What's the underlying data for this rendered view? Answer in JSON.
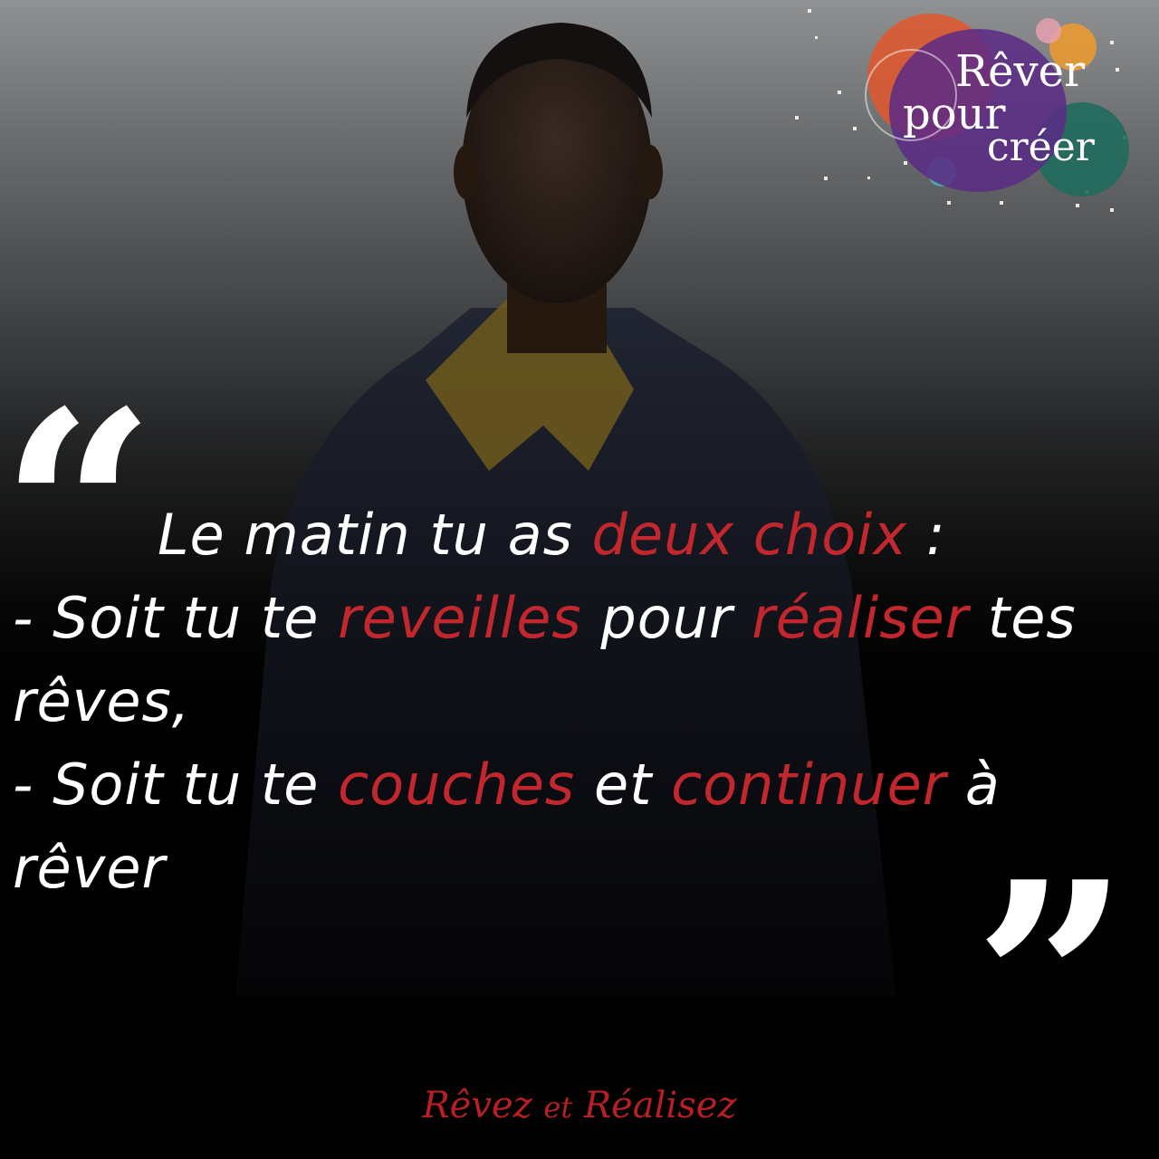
{
  "logo": {
    "line1": "Rêver",
    "line2": "pour",
    "line3": "créer"
  },
  "quote": {
    "open_mark": "“",
    "close_mark": "”",
    "lines": [
      [
        {
          "text": "Le matin tu as ",
          "hl": false
        },
        {
          "text": "deux choix",
          "hl": true
        },
        {
          "text": " :",
          "hl": false
        }
      ],
      [
        {
          "text": "- Soit tu te ",
          "hl": false
        },
        {
          "text": "reveilles",
          "hl": true
        },
        {
          "text": " pour ",
          "hl": false
        },
        {
          "text": "réaliser",
          "hl": true
        },
        {
          "text": " tes",
          "hl": false
        }
      ],
      [
        {
          "text": "rêves,",
          "hl": false
        }
      ],
      [
        {
          "text": "- Soit tu te ",
          "hl": false
        },
        {
          "text": "couches",
          "hl": true
        },
        {
          "text": " et ",
          "hl": false
        },
        {
          "text": "continuer",
          "hl": true
        },
        {
          "text": " à",
          "hl": false
        }
      ],
      [
        {
          "text": "rêver",
          "hl": false
        }
      ]
    ]
  },
  "footer": {
    "word1": "Rêvez",
    "word2": "et",
    "word3": "Réalisez"
  },
  "colors": {
    "highlight": "#c1272d",
    "text": "#ffffff",
    "logo_purple": "#5b2a86",
    "logo_orange": "#e2572b",
    "logo_green": "#1f6b5c"
  }
}
